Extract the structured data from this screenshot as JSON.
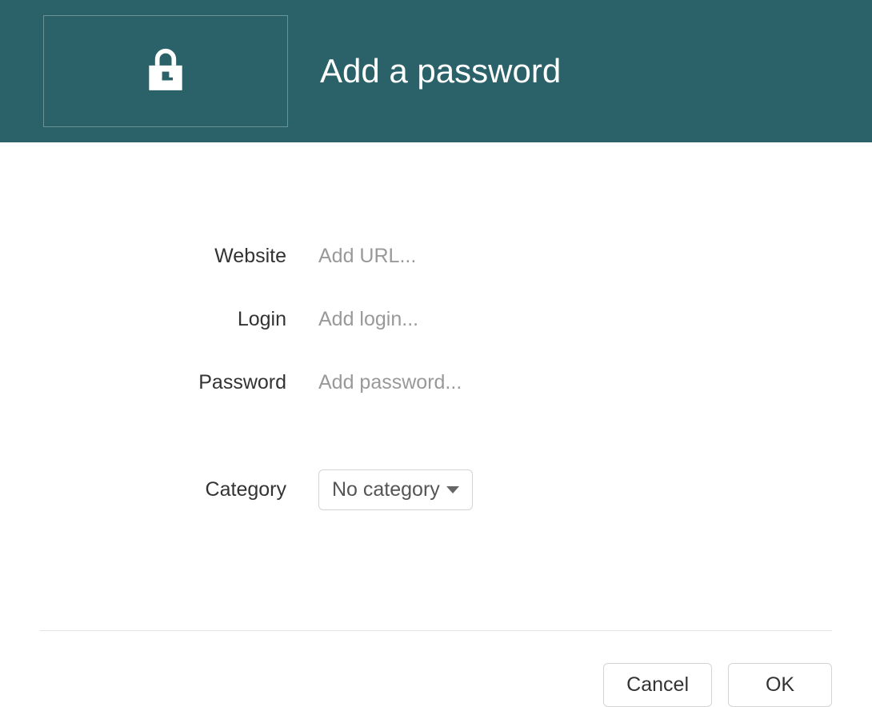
{
  "header": {
    "title": "Add a password"
  },
  "form": {
    "website": {
      "label": "Website",
      "placeholder": "Add URL...",
      "value": ""
    },
    "login": {
      "label": "Login",
      "placeholder": "Add login...",
      "value": ""
    },
    "password": {
      "label": "Password",
      "placeholder": "Add password...",
      "value": ""
    },
    "category": {
      "label": "Category",
      "selected": "No category"
    }
  },
  "buttons": {
    "cancel": "Cancel",
    "ok": "OK"
  }
}
